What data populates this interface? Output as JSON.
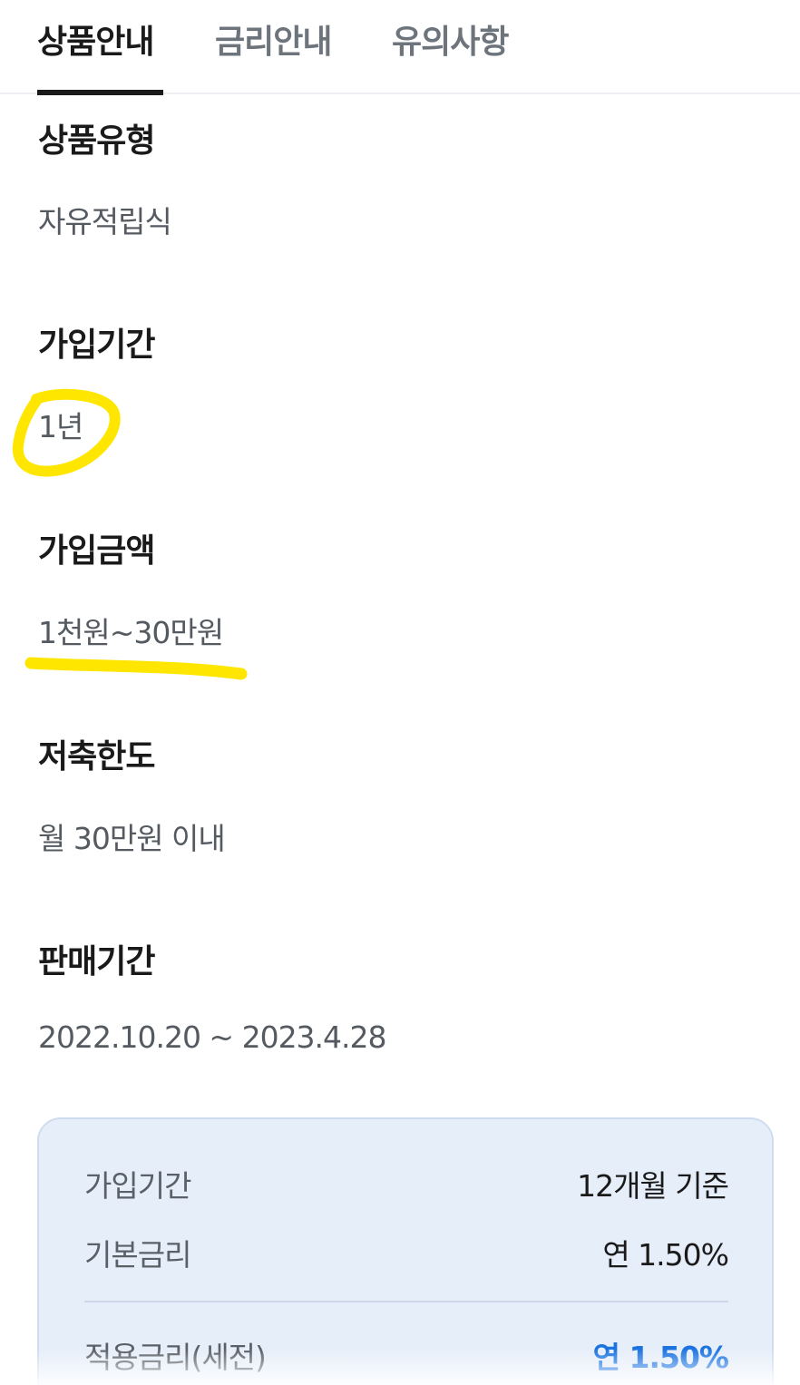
{
  "tabs": [
    {
      "label": "상품안내",
      "active": true
    },
    {
      "label": "금리안내",
      "active": false
    },
    {
      "label": "유의사항",
      "active": false
    }
  ],
  "sections": {
    "product_type": {
      "title": "상품유형",
      "value": "자유적립식"
    },
    "term": {
      "title": "가입기간",
      "value": "1년"
    },
    "amount": {
      "title": "가입금액",
      "value": "1천원~30만원"
    },
    "limit": {
      "title": "저축한도",
      "value": "월 30만원 이내"
    },
    "sale_period": {
      "title": "판매기간",
      "value": "2022.10.20 ~ 2023.4.28"
    }
  },
  "summary": {
    "rows": [
      {
        "label": "가입기간",
        "value": "12개월 기준"
      },
      {
        "label": "기본금리",
        "value": "연 1.50%"
      },
      {
        "label": "적용금리(세전)",
        "value": "연 1.50%"
      }
    ]
  },
  "colors": {
    "accent": "#1b73e0",
    "highlight": "#ffe600",
    "summary_bg": "#e6eef9"
  }
}
